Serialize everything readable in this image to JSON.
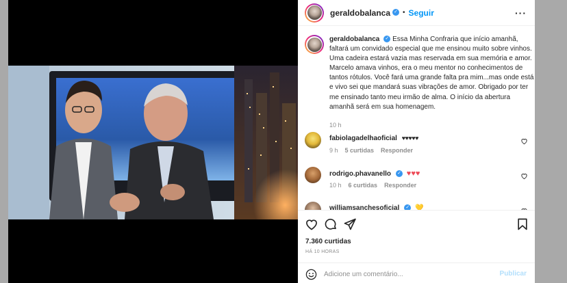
{
  "post": {
    "username": "geraldobalanca",
    "follow_label": "Seguir",
    "caption": "Essa Minha Confraria que início amanhã, faltará um convidado especial que me ensinou muito sobre vinhos. Uma cadeira estará vazia mas reservada em sua memória e amor. Marcelo amava vinhos, era o meu mentor no conhecimentos de tantos rótulos. Você fará uma grande falta pra mim...mas onde está e vivo sei que mandará suas vibrações de amor. Obrigado por ter me ensinado tanto meu irmão de alma. O início da abertura amanhã será em sua homenagem.",
    "caption_time": "10 h"
  },
  "comments": [
    {
      "username": "fabiolagadelhaoficial",
      "text": "♥♥♥♥♥",
      "time": "9 h",
      "likes": "5 curtidas",
      "reply": "Responder"
    },
    {
      "username": "rodrigo.phavanello",
      "text": "♥♥♥",
      "time": "10 h",
      "likes": "6 curtidas",
      "reply": "Responder"
    },
    {
      "username": "williamsanchesoficial",
      "text": "💛",
      "time": "",
      "likes": "",
      "reply": ""
    }
  ],
  "footer": {
    "likes": "7.360 curtidas",
    "time_ago": "HÁ 10 HORAS",
    "comment_placeholder": "Adicione um comentário...",
    "publish_label": "Publicar"
  },
  "icons": {
    "verified": "verified-badge-icon",
    "more": "more-options-icon",
    "like": "heart-icon",
    "comment": "comment-icon",
    "share": "share-icon",
    "save": "bookmark-icon",
    "emoji": "emoji-icon"
  },
  "colors": {
    "link_blue": "#0095f6",
    "heart_red": "#ed4956",
    "publish_disabled": "#b2dffc"
  }
}
